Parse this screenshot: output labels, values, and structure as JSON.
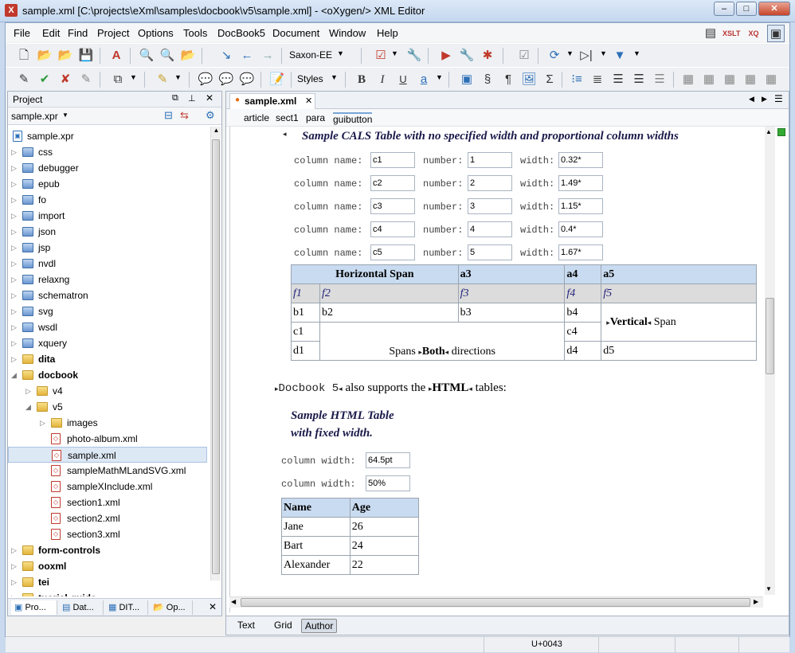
{
  "window": {
    "title": "sample.xml [C:\\projects\\eXml\\samples\\docbook\\v5\\sample.xml] - <oXygen/> XML Editor"
  },
  "menu": [
    "File",
    "Edit",
    "Find",
    "Project",
    "Options",
    "Tools",
    "DocBook5",
    "Document",
    "Window",
    "Help"
  ],
  "toolbar": {
    "transform_scenario": "Saxon-EE",
    "styles_label": "Styles",
    "u_label": "U",
    "a_label": "a"
  },
  "project": {
    "panel_title": "Project",
    "selector": "sample.xpr",
    "root": "sample.xpr",
    "items": [
      {
        "label": "css",
        "level": 1,
        "kind": "folder-blue",
        "bold": false,
        "expanded": false
      },
      {
        "label": "debugger",
        "level": 1,
        "kind": "folder-blue",
        "bold": false,
        "expanded": false
      },
      {
        "label": "epub",
        "level": 1,
        "kind": "folder-blue",
        "bold": false,
        "expanded": false
      },
      {
        "label": "fo",
        "level": 1,
        "kind": "folder-blue",
        "bold": false,
        "expanded": false
      },
      {
        "label": "import",
        "level": 1,
        "kind": "folder-blue",
        "bold": false,
        "expanded": false
      },
      {
        "label": "json",
        "level": 1,
        "kind": "folder-blue",
        "bold": false,
        "expanded": false
      },
      {
        "label": "jsp",
        "level": 1,
        "kind": "folder-blue",
        "bold": false,
        "expanded": false
      },
      {
        "label": "nvdl",
        "level": 1,
        "kind": "folder-blue",
        "bold": false,
        "expanded": false
      },
      {
        "label": "relaxng",
        "level": 1,
        "kind": "folder-blue",
        "bold": false,
        "expanded": false
      },
      {
        "label": "schematron",
        "level": 1,
        "kind": "folder-blue",
        "bold": false,
        "expanded": false
      },
      {
        "label": "svg",
        "level": 1,
        "kind": "folder-blue",
        "bold": false,
        "expanded": false
      },
      {
        "label": "wsdl",
        "level": 1,
        "kind": "folder-blue",
        "bold": false,
        "expanded": false
      },
      {
        "label": "xquery",
        "level": 1,
        "kind": "folder-blue",
        "bold": false,
        "expanded": false
      },
      {
        "label": "dita",
        "level": 1,
        "kind": "folder",
        "bold": true,
        "expanded": false
      },
      {
        "label": "docbook",
        "level": 1,
        "kind": "folder",
        "bold": true,
        "expanded": true
      },
      {
        "label": "v4",
        "level": 2,
        "kind": "folder",
        "bold": false,
        "expanded": false
      },
      {
        "label": "v5",
        "level": 2,
        "kind": "folder",
        "bold": false,
        "expanded": true
      },
      {
        "label": "images",
        "level": 3,
        "kind": "folder",
        "bold": false,
        "expanded": false
      },
      {
        "label": "photo-album.xml",
        "level": 3,
        "kind": "file",
        "bold": false
      },
      {
        "label": "sample.xml",
        "level": 3,
        "kind": "file",
        "bold": false,
        "selected": true
      },
      {
        "label": "sampleMathMLandSVG.xml",
        "level": 3,
        "kind": "file",
        "bold": false
      },
      {
        "label": "sampleXInclude.xml",
        "level": 3,
        "kind": "file",
        "bold": false
      },
      {
        "label": "section1.xml",
        "level": 3,
        "kind": "file",
        "bold": false
      },
      {
        "label": "section2.xml",
        "level": 3,
        "kind": "file",
        "bold": false
      },
      {
        "label": "section3.xml",
        "level": 3,
        "kind": "file",
        "bold": false
      },
      {
        "label": "form-controls",
        "level": 1,
        "kind": "folder",
        "bold": true,
        "expanded": false
      },
      {
        "label": "ooxml",
        "level": 1,
        "kind": "folder",
        "bold": true,
        "expanded": false
      },
      {
        "label": "tei",
        "level": 1,
        "kind": "folder",
        "bold": true,
        "expanded": false
      },
      {
        "label": "tuorial-guide",
        "level": 1,
        "kind": "folder",
        "bold": true,
        "expanded": false
      }
    ],
    "bottom_tabs": [
      "Pro...",
      "Dat...",
      "DIT...",
      "Op..."
    ]
  },
  "editor": {
    "tab": "sample.xml",
    "breadcrumb": [
      "article",
      "sect1",
      "para",
      "guibutton"
    ],
    "cals_title": "Sample CALS Table with no specified width and proportional column widths",
    "colspecs": [
      {
        "name": "c1",
        "number": "1",
        "width": "0.32*"
      },
      {
        "name": "c2",
        "number": "2",
        "width": "1.49*"
      },
      {
        "name": "c3",
        "number": "3",
        "width": "1.15*"
      },
      {
        "name": "c4",
        "number": "4",
        "width": "0.4*"
      },
      {
        "name": "c5",
        "number": "5",
        "width": "1.67*"
      }
    ],
    "labels": {
      "column_name": "column name:",
      "number": "number:",
      "width": "width:",
      "column_width": "column width:"
    },
    "cals": {
      "h_span": "Horizontal Span",
      "a3": "a3",
      "a4": "a4",
      "a5": "a5",
      "f1": "f1",
      "f2": "f2",
      "f3": "f3",
      "f4": "f4",
      "f5": "f5",
      "b1": "b1",
      "b2": "b2",
      "b3": "b3",
      "b4": "b4",
      "v_span_bold": "Vertical",
      "v_span": "Span",
      "c1": "c1",
      "c4": "c4",
      "spans": "Spans",
      "both": "Both",
      "directions": "directions",
      "d1": "d1",
      "d4": "d4",
      "d5": "d5"
    },
    "para": {
      "literal": "Docbook 5",
      "text1": "also supports the",
      "bold": "HTML",
      "text2": "tables:"
    },
    "html_title_1": "Sample HTML Table",
    "html_title_2": "with fixed width.",
    "html_widths": [
      "64.5pt",
      "50%"
    ],
    "html_table": {
      "headers": [
        "Name",
        "Age"
      ],
      "rows": [
        [
          "Jane",
          "26"
        ],
        [
          "Bart",
          "24"
        ],
        [
          "Alexander",
          "22"
        ]
      ]
    }
  },
  "modes": [
    "Text",
    "Grid",
    "Author"
  ],
  "status": {
    "unicode": "U+0043"
  }
}
